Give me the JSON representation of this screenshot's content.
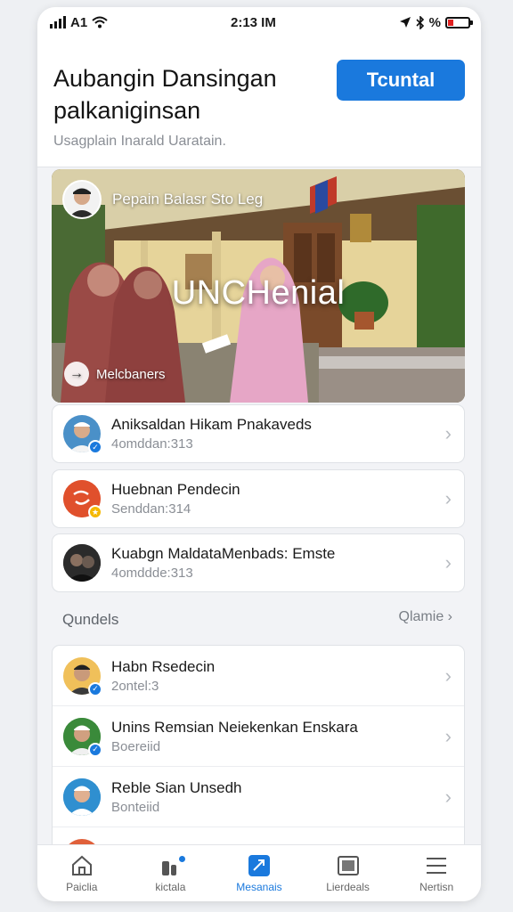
{
  "status_bar": {
    "carrier": "A1",
    "time": "2:13 IM",
    "battery_label": "%"
  },
  "header": {
    "title": "Aubangin Dansingan palkaniginsan",
    "subtitle": "Usagplain Inarald Uaratain.",
    "action_label": "Tcuntal"
  },
  "hero": {
    "author": "Pepain Balasr Sto Leg",
    "caption": "UNCHenial",
    "more_label": "Melcbaners"
  },
  "cards": [
    {
      "title": "Aniksaldan Hikam Pnakaveds",
      "subtitle": "4omddan:313",
      "avatar_color": "#4a90c8",
      "badge": "blue"
    },
    {
      "title": "Huebnan Pendecin",
      "subtitle": "Senddan:314",
      "avatar_color": "#e0502c",
      "badge": "gold"
    },
    {
      "title": "Kuabgn MaldataMenbads: Emste",
      "subtitle": "4omddde:313",
      "avatar_color": "#2b2b2b",
      "badge": "none"
    }
  ],
  "section": {
    "title": "Qundels",
    "link_label": "Qlamie"
  },
  "group_items": [
    {
      "title": "Habn Rsedecin",
      "subtitle": "2ontel:3",
      "avatar_color": "#f0c05a",
      "badge": "blue"
    },
    {
      "title": "Unins Remsian Neiekenkan Enskara",
      "subtitle": "Boereiid",
      "avatar_color": "#3a8a3a",
      "badge": "blue"
    },
    {
      "title": "Reble Sian Unsedh",
      "subtitle": "Bonteiid",
      "avatar_color": "#2f8fd0",
      "badge": "none"
    }
  ],
  "tabs": [
    {
      "label": "Paiclia",
      "icon": "home-icon",
      "active": false
    },
    {
      "label": "kictala",
      "icon": "apps-icon",
      "active": false
    },
    {
      "label": "Mesanais",
      "icon": "send-icon",
      "active": true
    },
    {
      "label": "Lierdeals",
      "icon": "media-icon",
      "active": false
    },
    {
      "label": "Nertisn",
      "icon": "menu-icon",
      "active": false
    }
  ],
  "colors": {
    "accent": "#1a79dd",
    "badge_gold": "#f5b800",
    "battery_low": "#e02020"
  }
}
